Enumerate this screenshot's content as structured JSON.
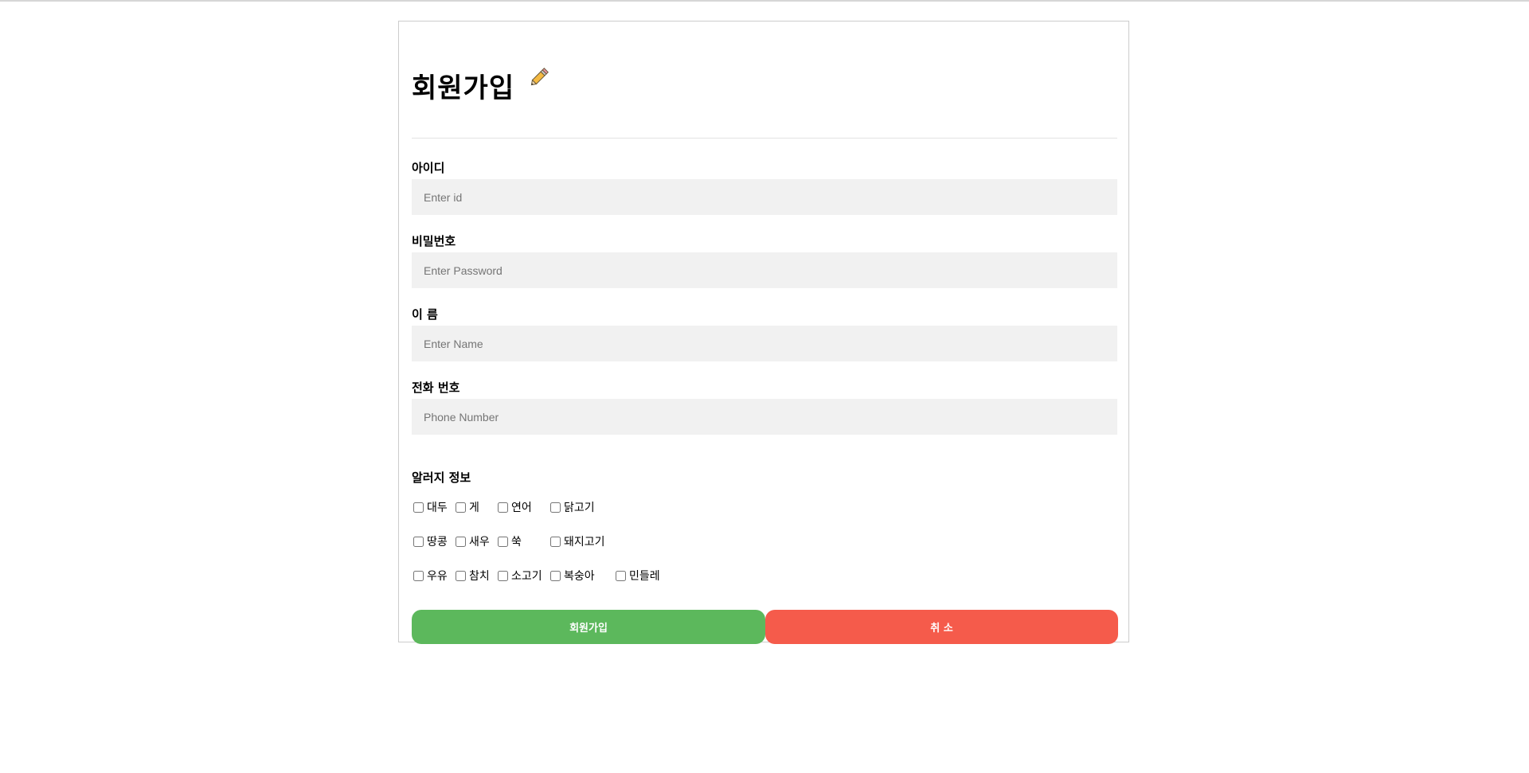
{
  "form": {
    "title": "회원가입",
    "title_icon": "pencil-icon",
    "fields": [
      {
        "label": "아이디",
        "placeholder": "Enter id",
        "value": ""
      },
      {
        "label": "비밀번호",
        "placeholder": "Enter Password",
        "value": ""
      },
      {
        "label": "이 름",
        "placeholder": "Enter Name",
        "value": ""
      },
      {
        "label": "전화 번호",
        "placeholder": "Phone Number",
        "value": ""
      }
    ],
    "allergy": {
      "title": "알러지 정보",
      "items": [
        "대두",
        "게",
        "연어",
        "닭고기",
        "땅콩",
        "새우",
        "쑥",
        "돼지고기",
        "우유",
        "참치",
        "소고기",
        "복숭아",
        "민들레"
      ],
      "checked": [
        false,
        false,
        false,
        false,
        false,
        false,
        false,
        false,
        false,
        false,
        false,
        false,
        false
      ]
    },
    "buttons": {
      "submit": "회원가입",
      "cancel": "취 소"
    }
  },
  "colors": {
    "submit": "#5cb85c",
    "cancel": "#f55b4b",
    "input_bg": "#f1f1f1"
  }
}
